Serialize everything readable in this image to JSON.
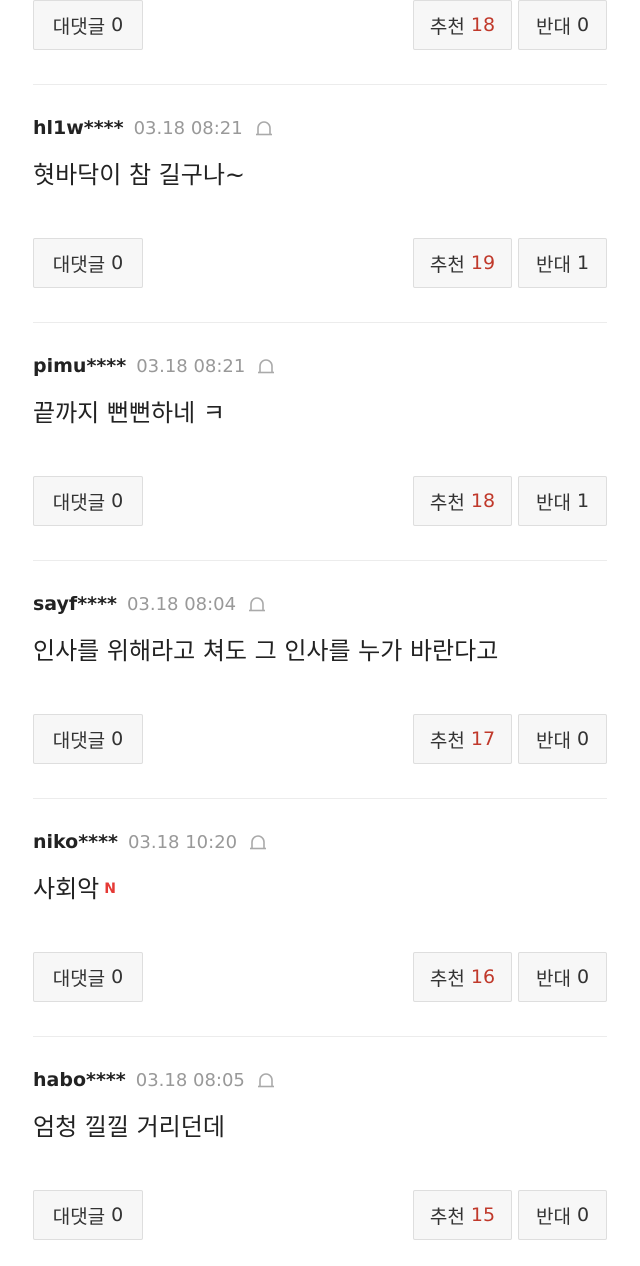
{
  "colors": {
    "like_count": "#c0392b",
    "new_badge": "#e53935"
  },
  "top_row": {
    "reply_label": "대댓글",
    "reply_count": "0",
    "like_label": "추천",
    "like_count": "18",
    "dislike_label": "반대",
    "dislike_count": "0"
  },
  "comments": [
    {
      "user": "hl1w****",
      "time": "03.18 08:21",
      "text": "혓바닥이 참 길구나~",
      "reply_label": "대댓글",
      "reply_count": "0",
      "like_label": "추천",
      "like_count": "19",
      "dislike_label": "반대",
      "dislike_count": "1"
    },
    {
      "user": "pimu****",
      "time": "03.18 08:21",
      "text": "끝까지 뻔뻔하네 ㅋ",
      "reply_label": "대댓글",
      "reply_count": "0",
      "like_label": "추천",
      "like_count": "18",
      "dislike_label": "반대",
      "dislike_count": "1"
    },
    {
      "user": "sayf****",
      "time": "03.18 08:04",
      "text": "인사를 위해라고 쳐도 그 인사를 누가 바란다고",
      "reply_label": "대댓글",
      "reply_count": "0",
      "like_label": "추천",
      "like_count": "17",
      "dislike_label": "반대",
      "dislike_count": "0"
    },
    {
      "user": "niko****",
      "time": "03.18 10:20",
      "text": "사회악",
      "badge": "N",
      "reply_label": "대댓글",
      "reply_count": "0",
      "like_label": "추천",
      "like_count": "16",
      "dislike_label": "반대",
      "dislike_count": "0"
    },
    {
      "user": "habo****",
      "time": "03.18 08:05",
      "text": "엄청 낄낄 거리던데",
      "reply_label": "대댓글",
      "reply_count": "0",
      "like_label": "추천",
      "like_count": "15",
      "dislike_label": "반대",
      "dislike_count": "0"
    }
  ]
}
